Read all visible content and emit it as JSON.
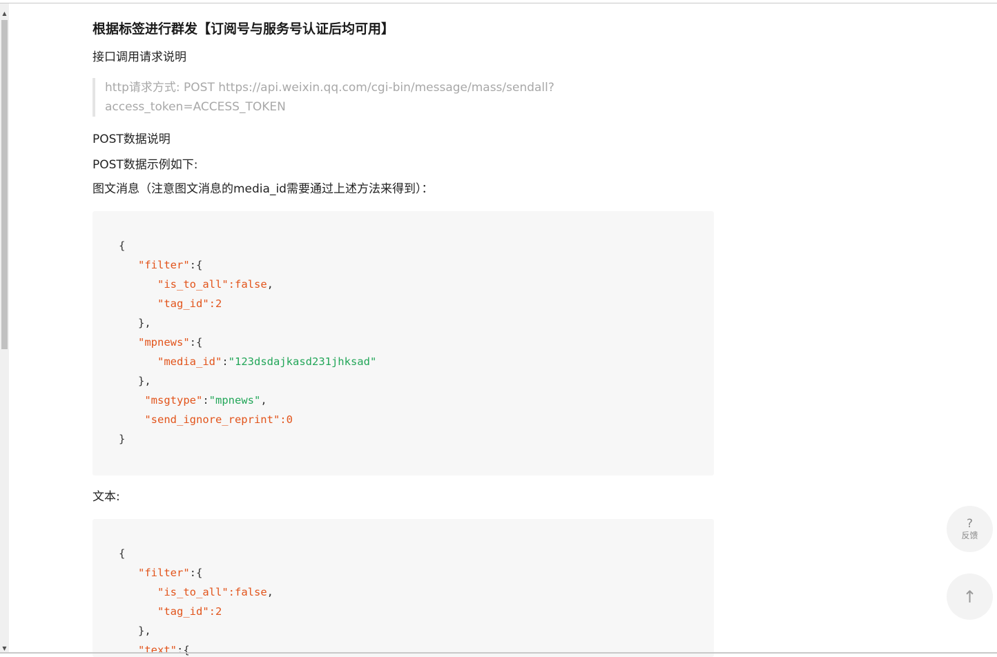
{
  "scroll": {
    "up_glyph": "▲",
    "down_glyph": "▼"
  },
  "section_title": "根据标签进行群发【订阅号与服务号认证后均可用】",
  "p1": "接口调用请求说明",
  "quote": {
    "line1": "http请求方式: POST https://api.weixin.qq.com/cgi-bin/message/mass/sendall?",
    "line2": "access_token=ACCESS_TOKEN"
  },
  "p2": "POST数据说明",
  "p3": "POST数据示例如下:",
  "p4": "图文消息（注意图文消息的media_id需要通过上述方法来得到）：",
  "code1": {
    "open": "{",
    "filter_key": "\"filter\"",
    "filter_open": ":{",
    "is_to_all_key": "\"is_to_all\"",
    "is_to_all_val": ":false",
    "comma": ",",
    "tag_id_key": "\"tag_id\"",
    "tag_id_val": ":2",
    "close_inner": "},",
    "mpnews_key": "\"mpnews\"",
    "mpnews_open": ":{",
    "media_id_key": "\"media_id\"",
    "colon": ":",
    "media_id_val": "\"123dsdajkasd231jhksad\"",
    "msgtype_key": "\"msgtype\"",
    "msgtype_val": "\"mpnews\"",
    "send_ignore_key": "\"send_ignore_reprint\"",
    "send_ignore_val": ":0",
    "close": "}"
  },
  "p5": "文本:",
  "code2": {
    "open": "{",
    "filter_key": "\"filter\"",
    "filter_open": ":{",
    "is_to_all_key": "\"is_to_all\"",
    "is_to_all_val": ":false",
    "comma": ",",
    "tag_id_key": "\"tag_id\"",
    "tag_id_val": ":2",
    "close_inner": "},",
    "text_key": "\"text\"",
    "text_open": ":{"
  },
  "fab": {
    "feedback_glyph": "?",
    "feedback_label": "反馈",
    "top_glyph": "↑"
  },
  "colors": {
    "key": "#e2541b",
    "string": "#22a658",
    "code_bg": "#f7f7f7",
    "quote_text": "#a8a8a8"
  }
}
